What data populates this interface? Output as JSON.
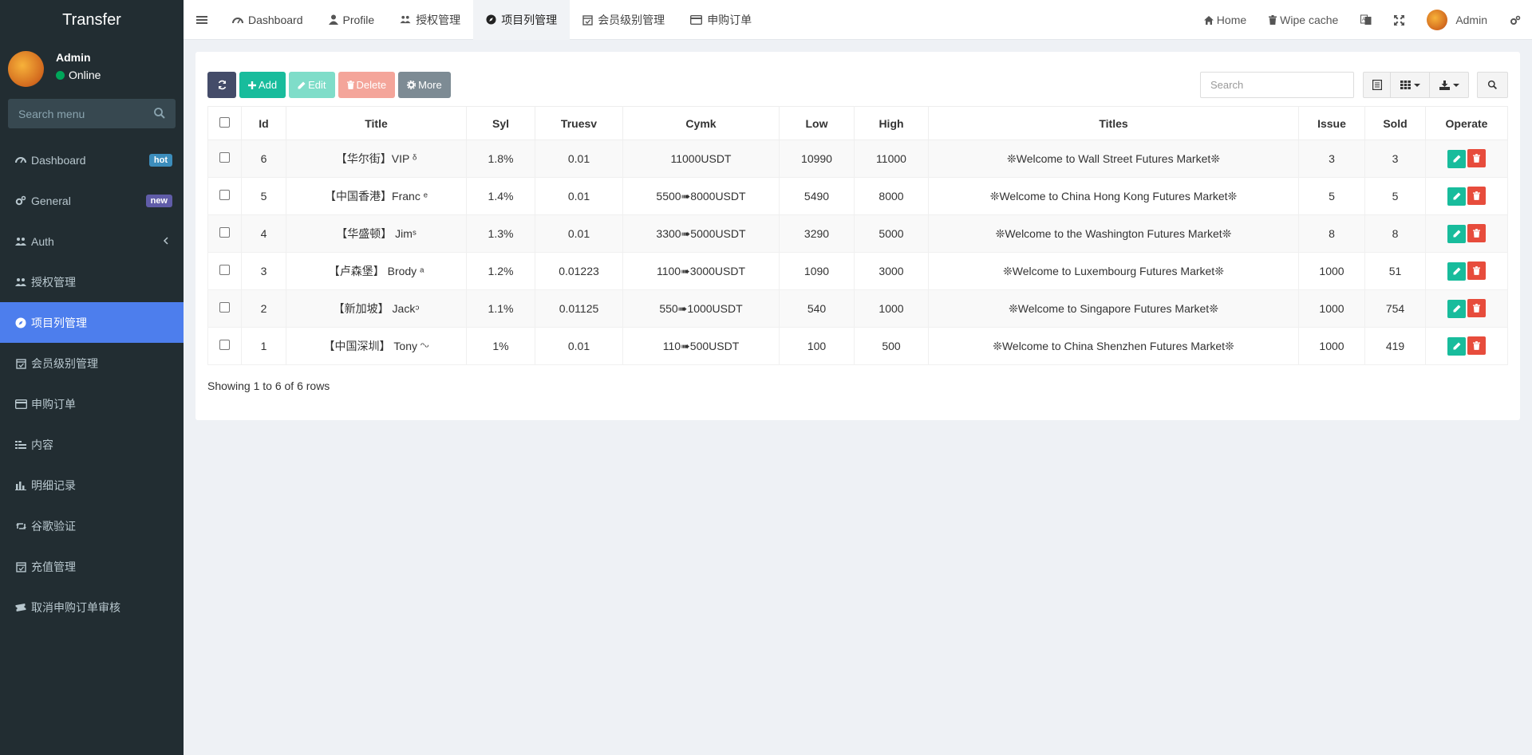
{
  "sidebar": {
    "brand": "Transfer",
    "user": {
      "name": "Admin",
      "status": "Online"
    },
    "search_placeholder": "Search menu",
    "items": [
      {
        "label": "Dashboard",
        "icon": "dashboard-icon",
        "badge": "hot",
        "badge_color": "#3c8dbc"
      },
      {
        "label": "General",
        "icon": "cogs-icon",
        "badge": "new",
        "badge_color": "#605ca8"
      },
      {
        "label": "Auth",
        "icon": "group-icon"
      },
      {
        "label": "授权管理",
        "icon": "group-icon"
      },
      {
        "label": "项目列管理",
        "icon": "compass-icon",
        "active": true
      },
      {
        "label": "会员级别管理",
        "icon": "calendar-check-icon"
      },
      {
        "label": "申购订单",
        "icon": "credit-card-icon"
      },
      {
        "label": "内容",
        "icon": "list-icon"
      },
      {
        "label": "明细记录",
        "icon": "bar-chart-icon"
      },
      {
        "label": "谷歌验证",
        "icon": "retweet-icon"
      },
      {
        "label": "充值管理",
        "icon": "calendar-check-icon"
      },
      {
        "label": "取消申购订单审核",
        "icon": "ticket-icon"
      }
    ]
  },
  "topnav": {
    "tabs": [
      {
        "label": "Dashboard",
        "icon": "dashboard-icon"
      },
      {
        "label": "Profile",
        "icon": "user-icon"
      },
      {
        "label": "授权管理",
        "icon": "group-icon"
      },
      {
        "label": "项目列管理",
        "icon": "compass-icon",
        "active": true
      },
      {
        "label": "会员级别管理",
        "icon": "calendar-check-icon"
      },
      {
        "label": "申购订单",
        "icon": "credit-card-icon"
      }
    ],
    "right": {
      "home": "Home",
      "wipe": "Wipe cache",
      "admin": "Admin"
    }
  },
  "toolbar": {
    "add": "Add",
    "edit": "Edit",
    "delete": "Delete",
    "more": "More",
    "search_placeholder": "Search"
  },
  "table": {
    "columns": [
      "Id",
      "Title",
      "Syl",
      "Truesv",
      "Cymk",
      "Low",
      "High",
      "Titles",
      "Issue",
      "Sold",
      "Operate"
    ],
    "rows": [
      {
        "id": "6",
        "title": "【华尔街】VIP ᵟ",
        "syl": "1.8%",
        "truesv": "0.01",
        "cymk": "11000USDT",
        "low": "10990",
        "high": "11000",
        "titles": "❊Welcome to Wall Street Futures Market❊",
        "issue": "3",
        "sold": "3"
      },
      {
        "id": "5",
        "title": "【中国香港】Franc ᵉ",
        "syl": "1.4%",
        "truesv": "0.01",
        "cymk": "5500➠8000USDT",
        "low": "5490",
        "high": "8000",
        "titles": "❊Welcome to China Hong Kong Futures Market❊",
        "issue": "5",
        "sold": "5"
      },
      {
        "id": "4",
        "title": "【华盛顿】 Jimˢ",
        "syl": "1.3%",
        "truesv": "0.01",
        "cymk": "3300➠5000USDT",
        "low": "3290",
        "high": "5000",
        "titles": "❊Welcome to the Washington Futures Market❊",
        "issue": "8",
        "sold": "8"
      },
      {
        "id": "3",
        "title": "【卢森堡】 Brody ᵃ",
        "syl": "1.2%",
        "truesv": "0.01223",
        "cymk": "1100➠3000USDT",
        "low": "1090",
        "high": "3000",
        "titles": "❊Welcome to Luxembourg Futures Market❊",
        "issue": "1000",
        "sold": "51"
      },
      {
        "id": "2",
        "title": "【新加坡】 Jackᵓ",
        "syl": "1.1%",
        "truesv": "0.01125",
        "cymk": "550➠1000USDT",
        "low": "540",
        "high": "1000",
        "titles": "❊Welcome to Singapore Futures Market❊",
        "issue": "1000",
        "sold": "754"
      },
      {
        "id": "1",
        "title": "【中国深圳】 Tony ᵔᵕ",
        "syl": "1%",
        "truesv": "0.01",
        "cymk": "110➠500USDT",
        "low": "100",
        "high": "500",
        "titles": "❊Welcome to China Shenzhen Futures Market❊",
        "issue": "1000",
        "sold": "419"
      }
    ],
    "footer": "Showing 1 to 6 of 6 rows"
  },
  "colors": {
    "sidebar_bg": "#222d32",
    "active_menu": "#4d7eed",
    "add": "#18bc9c",
    "delete": "#e74c3c",
    "refresh": "#444c69"
  }
}
